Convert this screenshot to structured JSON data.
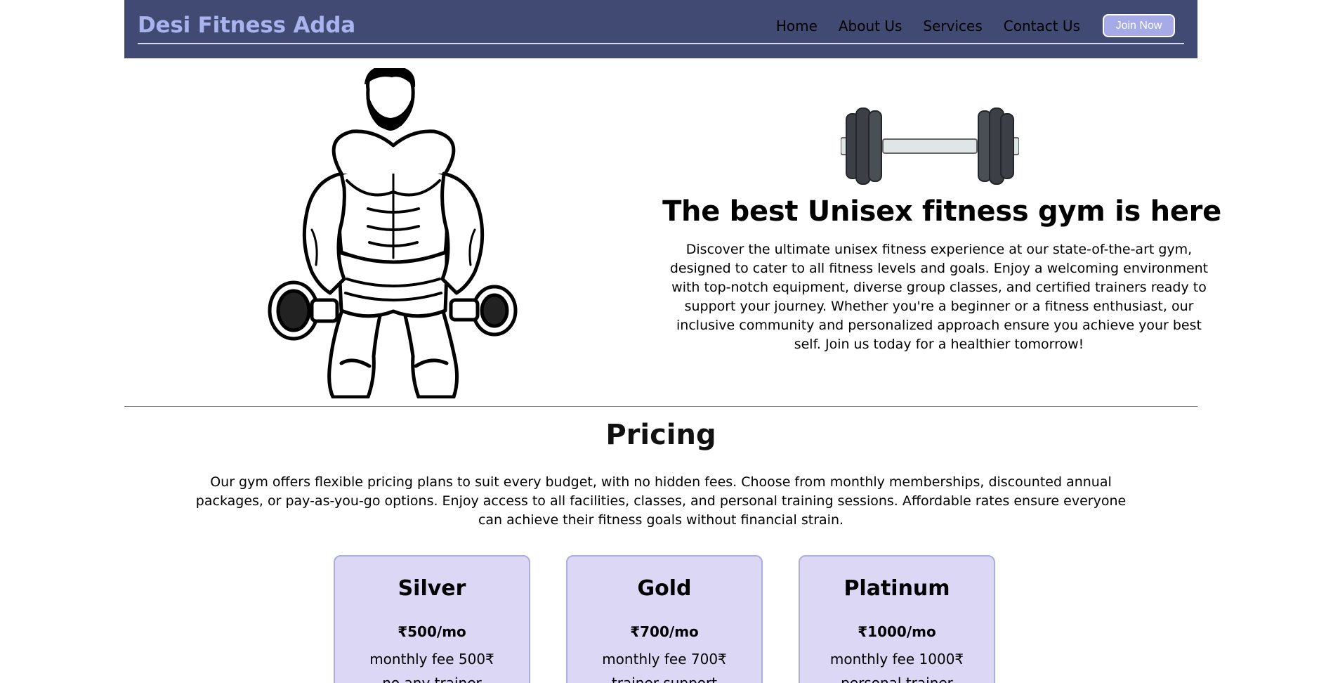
{
  "navbar": {
    "brand": "Desi Fitness Adda",
    "links": [
      "Home",
      "About Us",
      "Services",
      "Contact Us"
    ],
    "join_label": "Join Now"
  },
  "hero": {
    "title": "The best Unisex fitness gym is here",
    "description": "Discover the ultimate unisex fitness experience at our state-of-the-art gym, designed to cater to all fitness levels and goals. Enjoy a welcoming environment with top-notch equipment, diverse group classes, and certified trainers ready to support your journey. Whether you're a beginner or a fitness enthusiast, our inclusive community and personalized approach ensure you achieve your best self. Join us today for a healthier tomorrow!",
    "figure_icon": "bodybuilder-illustration",
    "dumbbell_icon": "dumbbell-icon"
  },
  "pricing": {
    "title": "Pricing",
    "description": "Our gym offers flexible pricing plans to suit every budget, with no hidden fees. Choose from monthly memberships, discounted annual packages, or pay-as-you-go options. Enjoy access to all facilities, classes, and personal training sessions. Affordable rates ensure everyone can achieve their fitness goals without financial strain.",
    "plans": [
      {
        "name": "Silver",
        "price": "₹500/mo",
        "fee": "monthly fee 500₹",
        "feature": "no any trainer"
      },
      {
        "name": "Gold",
        "price": "₹700/mo",
        "fee": "monthly fee 700₹",
        "feature": "trainer support"
      },
      {
        "name": "Platinum",
        "price": "₹1000/mo",
        "fee": "monthly fee 1000₹",
        "feature": "personal trainer"
      }
    ]
  },
  "colors": {
    "navbar_bg": "#414a72",
    "brand": "#a9b4ee",
    "button_bg": "#a6abe8",
    "card_bg": "#dcd7f5",
    "card_border": "#a9aede"
  }
}
